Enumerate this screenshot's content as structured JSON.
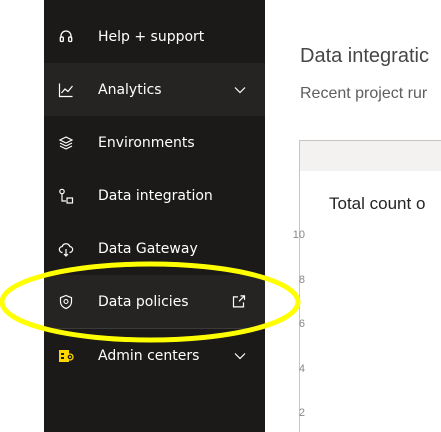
{
  "sidebar": {
    "items": [
      {
        "label": "Help + support",
        "icon": "headset-icon"
      },
      {
        "label": "Analytics",
        "icon": "line-chart-icon",
        "expandable": true
      },
      {
        "label": "Environments",
        "icon": "layers-icon"
      },
      {
        "label": "Data integration",
        "icon": "data-integration-icon"
      },
      {
        "label": "Data Gateway",
        "icon": "cloud-gateway-icon"
      },
      {
        "label": "Data policies",
        "icon": "shield-icon",
        "external": true
      },
      {
        "label": "Admin centers",
        "icon": "admin-centers-icon",
        "expandable": true
      }
    ]
  },
  "main": {
    "title": "Data integratic",
    "subtitle": "Recent project rur",
    "chart": {
      "title": "Total count o",
      "y_ticks": [
        "10",
        "8",
        "6",
        "4",
        "2"
      ]
    }
  },
  "colors": {
    "sidebar_bg": "#1b1a19",
    "highlight_bg": "#252423",
    "annotation": "#ffff00",
    "admin_icon": "#ffd700"
  }
}
